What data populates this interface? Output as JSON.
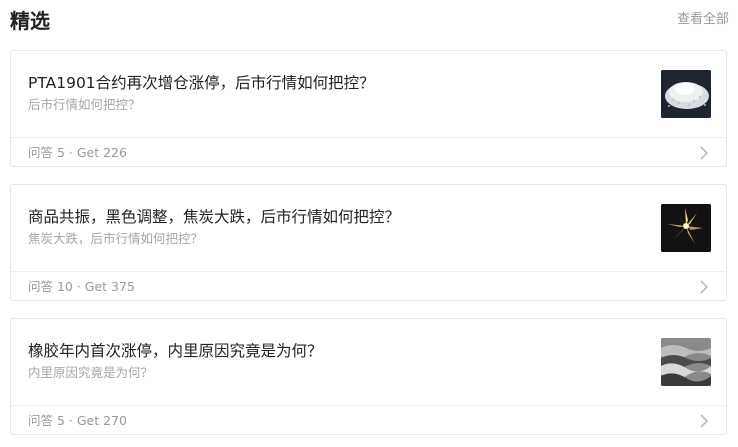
{
  "header": {
    "title": "精选",
    "view_all_label": "查看全部"
  },
  "cards": [
    {
      "title": "PTA1901合约再次增仓涨停，后市行情如何把控？",
      "subtitle": "后市行情如何把控？",
      "stats": "问答 5 · Get 226",
      "thumbnail_icon": "white-granules-image"
    },
    {
      "title": "商品共振，黑色调整，焦炭大跌，后市行情如何把控？",
      "subtitle": "焦炭大跌，后市行情如何把控？",
      "stats": "问答 10 · Get 375",
      "thumbnail_icon": "metal-flower-image"
    },
    {
      "title": "橡胶年内首次涨停，内里原因究竟是为何？",
      "subtitle": "内里原因究竟是为何？",
      "stats": "问答 5 · Get 270",
      "thumbnail_icon": "rubber-sheets-image"
    }
  ],
  "colors": {
    "title_text": "#222222",
    "secondary_text": "#999999",
    "card_border": "#e6e6e6",
    "chevron": "#bbbbbb"
  }
}
